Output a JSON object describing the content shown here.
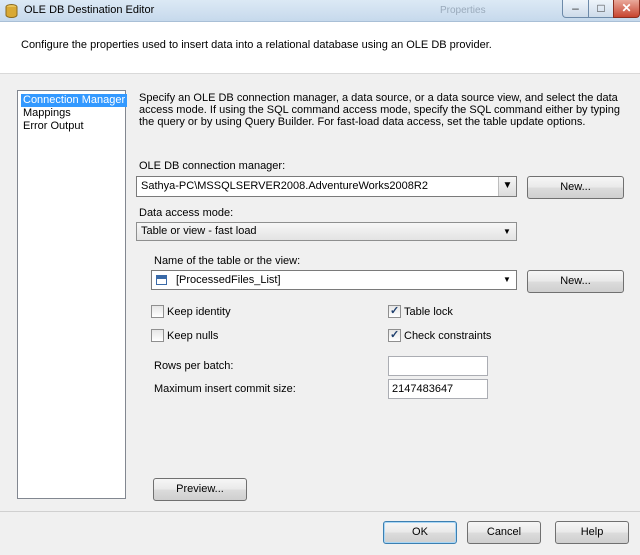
{
  "window": {
    "title": "OLE DB Destination Editor",
    "background_title": "Properties"
  },
  "header": {
    "text": "Configure the properties used to insert data into a relational database using an OLE DB provider."
  },
  "nav": {
    "items": [
      {
        "label": "Connection Manager",
        "selected": true
      },
      {
        "label": "Mappings",
        "selected": false
      },
      {
        "label": "Error Output",
        "selected": false
      }
    ]
  },
  "description": "Specify an OLE DB connection manager, a data source, or a data source view, and select the data access mode. If using the SQL command access mode, specify the SQL command either by typing the query or by using Query Builder. For fast-load data access, set the table update options.",
  "connection": {
    "label": "OLE DB connection manager:",
    "value": "Sathya-PC\\MSSQLSERVER2008.AdventureWorks2008R2",
    "new_label": "New..."
  },
  "access_mode": {
    "label": "Data access mode:",
    "value": "Table or view - fast load"
  },
  "table": {
    "label": "Name of the table or the view:",
    "value": "[ProcessedFiles_List]",
    "new_label": "New..."
  },
  "options": {
    "keep_identity": {
      "label": "Keep identity",
      "checked": false
    },
    "keep_nulls": {
      "label": "Keep nulls",
      "checked": false
    },
    "table_lock": {
      "label": "Table lock",
      "checked": true
    },
    "check_constraints": {
      "label": "Check constraints",
      "checked": true
    }
  },
  "rows_per_batch": {
    "label": "Rows per batch:",
    "value": ""
  },
  "max_commit": {
    "label": "Maximum insert commit size:",
    "value": "2147483647"
  },
  "buttons": {
    "preview": "Preview...",
    "ok": "OK",
    "cancel": "Cancel",
    "help": "Help"
  },
  "window_controls": {
    "minimize": "‒",
    "maximize": "□",
    "close": "✕"
  }
}
